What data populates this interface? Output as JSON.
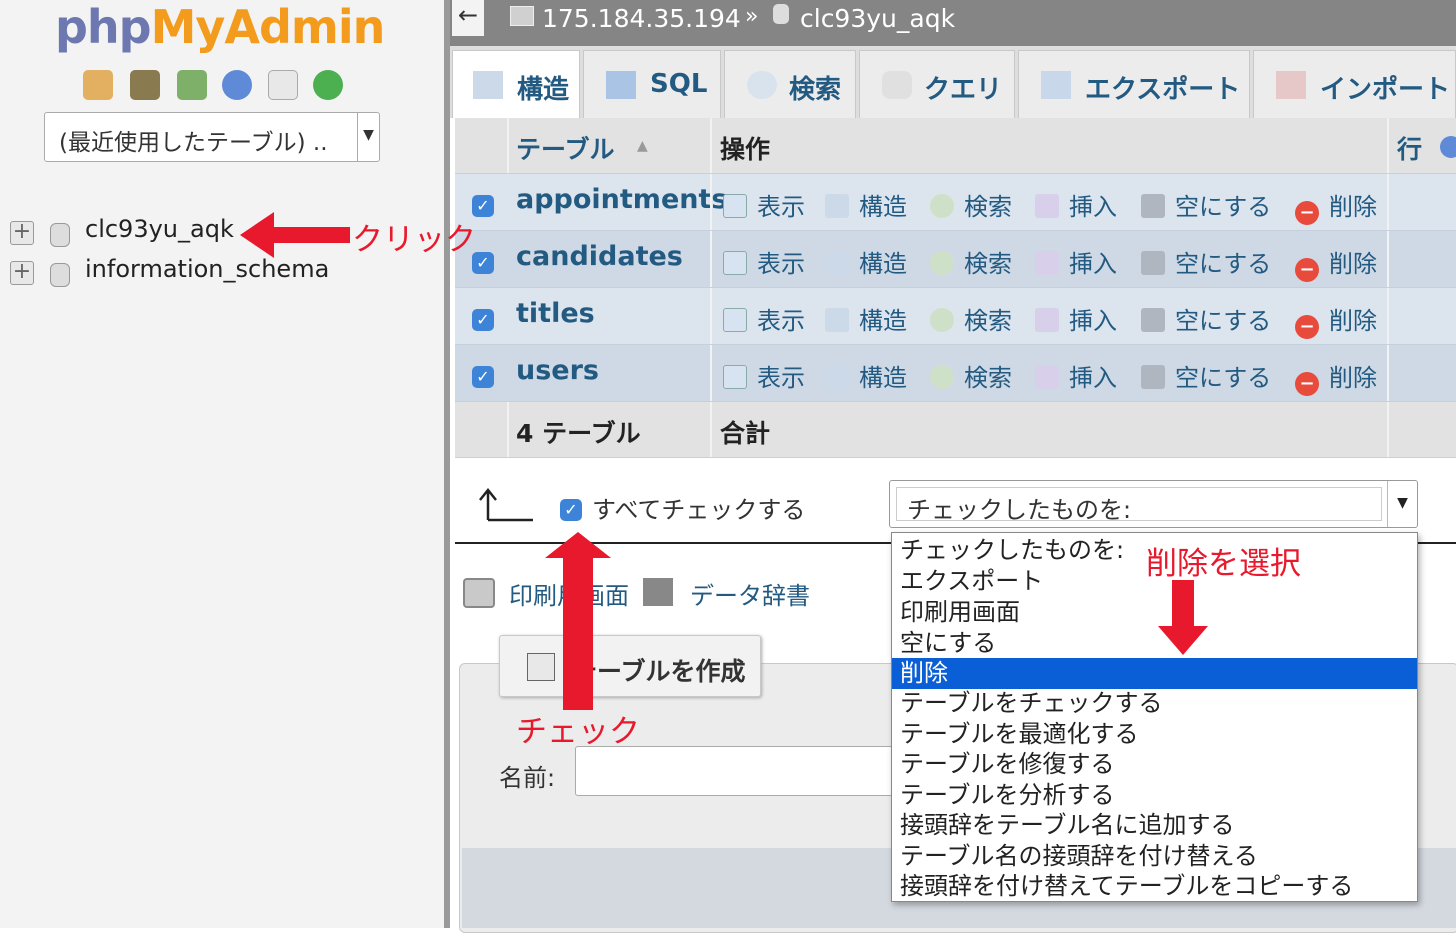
{
  "nav": {
    "logo_php": "php",
    "logo_myadmin": "MyAdmin",
    "recent_select": "(最近使用したテーブル) ..",
    "databases": [
      "clc93yu_aqk",
      "information_schema"
    ]
  },
  "breadcrumb": {
    "back": "←",
    "server": "175.184.35.194",
    "separator": "»",
    "database": "clc93yu_aqk"
  },
  "tabs": [
    "構造",
    "SQL",
    "検索",
    "クエリ",
    "エクスポート",
    "インポート"
  ],
  "table": {
    "header": {
      "table_col": "テーブル",
      "sort": "▲",
      "action_col": "操作",
      "rows_col": "行"
    },
    "actions": [
      "表示",
      "構造",
      "検索",
      "挿入",
      "空にする",
      "削除"
    ],
    "rows": [
      {
        "name": "appointments",
        "checked": true
      },
      {
        "name": "candidates",
        "checked": true
      },
      {
        "name": "titles",
        "checked": true
      },
      {
        "name": "users",
        "checked": true
      }
    ],
    "footer": {
      "count": "4 テーブル",
      "total": "合計"
    },
    "check_mark": "✓"
  },
  "controls": {
    "check_all_label": "すべてチェックする",
    "bulk_select_value": "チェックしたものを:",
    "bulk_options": [
      "チェックしたものを:",
      "エクスポート",
      "印刷用画面",
      "空にする",
      "削除",
      "テーブルをチェックする",
      "テーブルを最適化する",
      "テーブルを修復する",
      "テーブルを分析する",
      "接頭辞をテーブル名に追加する",
      "テーブル名の接頭辞を付け替える",
      "接頭辞を付け替えてテーブルをコピーする"
    ],
    "bulk_selected_index": 4,
    "print_link": "印刷用画面",
    "dictionary_link": "データ辞書",
    "create_table_button": "テーブルを作成",
    "name_label": "名前:"
  },
  "annotations": {
    "click": "クリック",
    "check": "チェック",
    "select_delete": "削除を選択"
  },
  "colors": {
    "link": "#235a81",
    "annotation_red": "#e8192c",
    "selection_blue": "#0a5fd6",
    "checkbox_blue": "#3d84d8"
  }
}
